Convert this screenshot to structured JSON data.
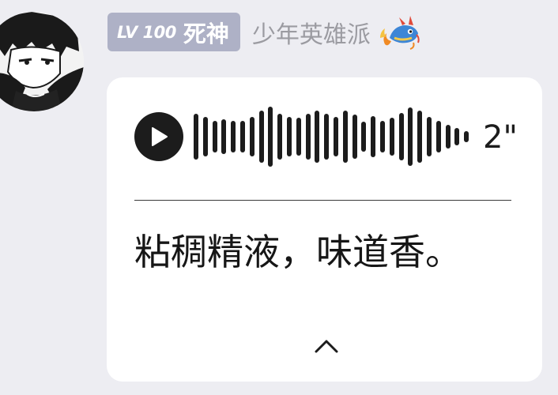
{
  "message": {
    "sender": {
      "avatar_icon": "anime-character-avatar-icon",
      "level_label": "LV 100",
      "rank_title": "死神",
      "name": "少年英雄派",
      "name_color": "#9b9ba1",
      "badge_color": "#aeb1c6",
      "badge_icon": "dragon-icon"
    },
    "voice": {
      "play_icon": "play-icon",
      "duration": "2\"",
      "transcript": "粘稠精液，味道香。",
      "collapse_icon": "chevron-up-icon"
    }
  }
}
